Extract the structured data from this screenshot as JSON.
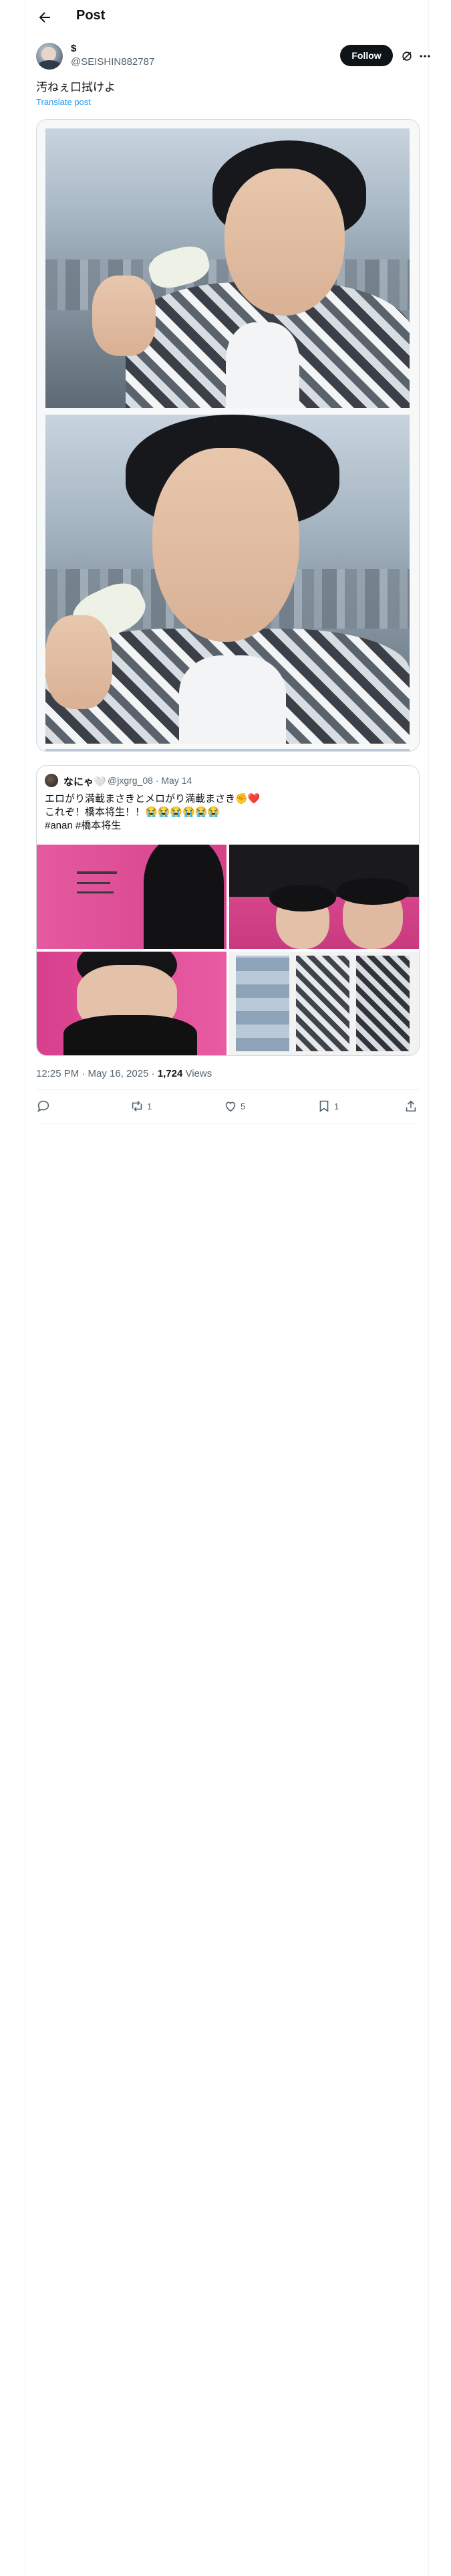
{
  "header": {
    "title": "Post"
  },
  "author": {
    "display_name": "$",
    "handle": "@SEISHIN882787",
    "follow_label": "Follow"
  },
  "post": {
    "text": "汚ねぇ口拭けよ",
    "translate_label": "Translate post"
  },
  "quote": {
    "name": "なにゃ🤍",
    "handle": "@jxgrg_08",
    "date": "May 14",
    "lines": [
      "エロがり満載まさきとメロがり満載まさき✊❤️",
      "これぞ！橋本将生！！😭😭😭😭😭😭",
      "#anan #橋本将生"
    ]
  },
  "meta": {
    "time": "12:25 PM · May 16, 2025 · ",
    "views_count": "1,724",
    "views_label": " Views"
  },
  "actions": {
    "replies": "",
    "reposts": "1",
    "likes": "5",
    "bookmarks": "1"
  },
  "colors": {
    "accent": "#1d9bf0",
    "text": "#0f1419",
    "muted": "#536471",
    "follow_bg": "#0f1419"
  }
}
